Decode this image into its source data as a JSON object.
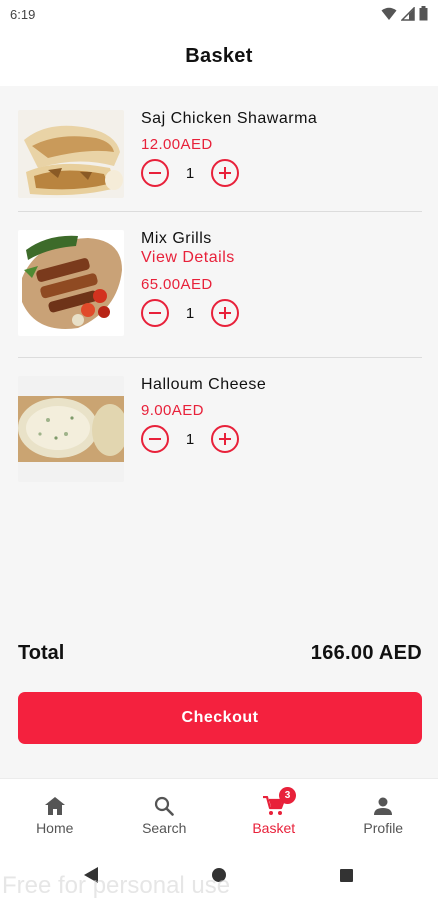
{
  "status_bar": {
    "time": "6:19"
  },
  "header": {
    "title": "Basket"
  },
  "items": [
    {
      "name": "Saj Chicken Shawarma",
      "price": "12.00AED",
      "quantity": "1"
    },
    {
      "name": "Mix Grills",
      "link": "View Details",
      "price": "65.00AED",
      "quantity": "1"
    },
    {
      "name": "Halloum Cheese",
      "price": "9.00AED",
      "quantity": "1"
    }
  ],
  "summary": {
    "total_label": "Total",
    "total_value": "166.00 AED"
  },
  "checkout": {
    "label": "Checkout"
  },
  "bottom_nav": {
    "items": [
      {
        "label": "Home",
        "icon": "home-icon"
      },
      {
        "label": "Search",
        "icon": "search-icon"
      },
      {
        "label": "Basket",
        "icon": "cart-icon",
        "badge": "3",
        "active": true
      },
      {
        "label": "Profile",
        "icon": "person-icon"
      }
    ]
  },
  "colors": {
    "accent": "#e8213a",
    "button": "#f4213e",
    "background": "#f6f6f6"
  },
  "watermark": "Free for personal use"
}
